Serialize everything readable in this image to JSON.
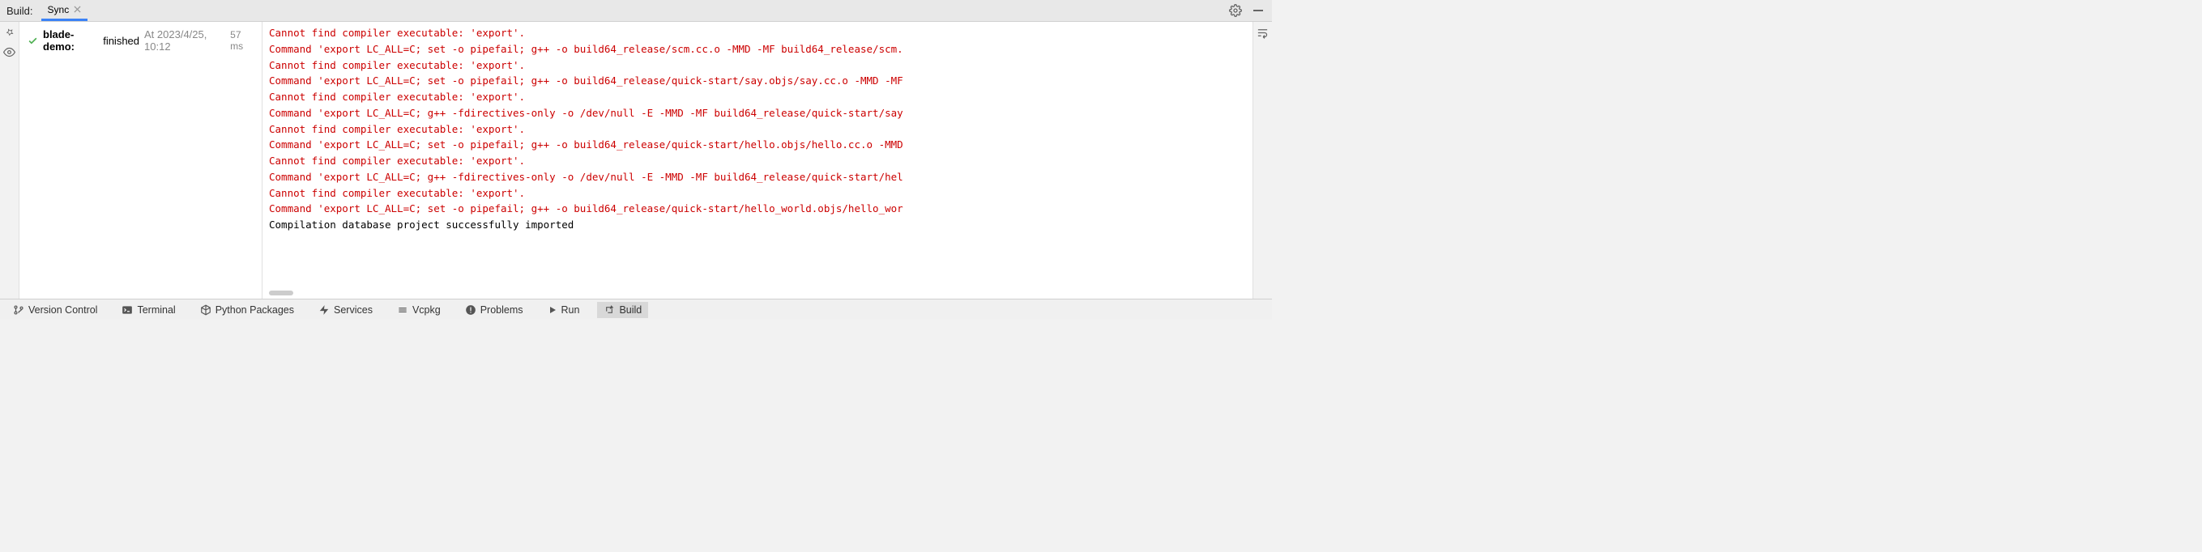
{
  "header": {
    "label": "Build:",
    "tab": {
      "name": "Sync"
    }
  },
  "tree": {
    "project": "blade-demo:",
    "status": "finished",
    "timestamp": "At 2023/4/25, 10:12",
    "duration": "57 ms"
  },
  "console": {
    "lines": [
      {
        "text": "Cannot find compiler executable: 'export'.",
        "type": "error"
      },
      {
        "text": "Command 'export LC_ALL=C; set -o pipefail; g++ -o build64_release/scm.cc.o -MMD -MF build64_release/scm.",
        "type": "error"
      },
      {
        "text": "Cannot find compiler executable: 'export'.",
        "type": "error"
      },
      {
        "text": "Command 'export LC_ALL=C; set -o pipefail; g++ -o build64_release/quick-start/say.objs/say.cc.o -MMD -MF",
        "type": "error"
      },
      {
        "text": "Cannot find compiler executable: 'export'.",
        "type": "error"
      },
      {
        "text": "Command 'export LC_ALL=C; g++ -fdirectives-only -o /dev/null -E -MMD -MF build64_release/quick-start/say",
        "type": "error"
      },
      {
        "text": "Cannot find compiler executable: 'export'.",
        "type": "error"
      },
      {
        "text": "Command 'export LC_ALL=C; set -o pipefail; g++ -o build64_release/quick-start/hello.objs/hello.cc.o -MMD",
        "type": "error"
      },
      {
        "text": "Cannot find compiler executable: 'export'.",
        "type": "error"
      },
      {
        "text": "Command 'export LC_ALL=C; g++ -fdirectives-only -o /dev/null -E -MMD -MF build64_release/quick-start/hel",
        "type": "error"
      },
      {
        "text": "Cannot find compiler executable: 'export'.",
        "type": "error"
      },
      {
        "text": "Command 'export LC_ALL=C; set -o pipefail; g++ -o build64_release/quick-start/hello_world.objs/hello_wor",
        "type": "error"
      },
      {
        "text": "Compilation database project successfully imported",
        "type": "info"
      }
    ]
  },
  "bottombar": {
    "items": [
      {
        "label": "Version Control",
        "icon": "branch"
      },
      {
        "label": "Terminal",
        "icon": "terminal"
      },
      {
        "label": "Python Packages",
        "icon": "packages"
      },
      {
        "label": "Services",
        "icon": "services"
      },
      {
        "label": "Vcpkg",
        "icon": "vcpkg"
      },
      {
        "label": "Problems",
        "icon": "problems"
      },
      {
        "label": "Run",
        "icon": "run"
      },
      {
        "label": "Build",
        "icon": "build",
        "selected": true
      }
    ]
  },
  "icons": {
    "gear": "gear-icon",
    "minimize": "minimize-icon",
    "pin": "pin-icon",
    "eye": "eye-icon",
    "softwrap": "softwrap-icon"
  }
}
